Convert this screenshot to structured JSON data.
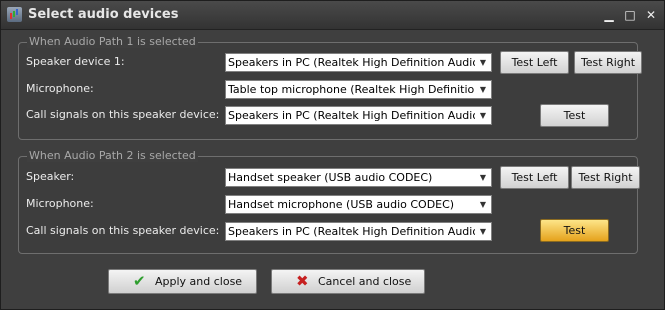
{
  "window": {
    "title": "Select audio devices",
    "minimize": "▁",
    "maximize": "□",
    "close": "✕"
  },
  "colors": {
    "active_button": "#f1b93a",
    "check_icon": "#2e9e2e",
    "x_icon": "#c62020"
  },
  "path1": {
    "legend": "When Audio Path 1 is selected",
    "speaker_label": "Speaker device 1:",
    "speaker_value": "Speakers in PC (Realtek High Definition Audio)",
    "mic_label": "Microphone:",
    "mic_value": "Table top microphone (Realtek High Definition Audio",
    "call_label": "Call signals on this speaker device:",
    "call_value": "Speakers in PC (Realtek High Definition Audio)",
    "test_left": "Test Left",
    "test_right": "Test Right",
    "test": "Test"
  },
  "path2": {
    "legend": "When Audio Path 2 is selected",
    "speaker_label": "Speaker:",
    "speaker_value": "Handset speaker (USB audio CODEC)",
    "mic_label": "Microphone:",
    "mic_value": "Handset microphone (USB audio CODEC)",
    "call_label": "Call signals on this speaker device:",
    "call_value": "Speakers in PC (Realtek High Definition Audio)",
    "test_left": "Test Left",
    "test_right": "Test Right",
    "test": "Test"
  },
  "footer": {
    "apply": "Apply and close",
    "cancel": "Cancel and close"
  }
}
